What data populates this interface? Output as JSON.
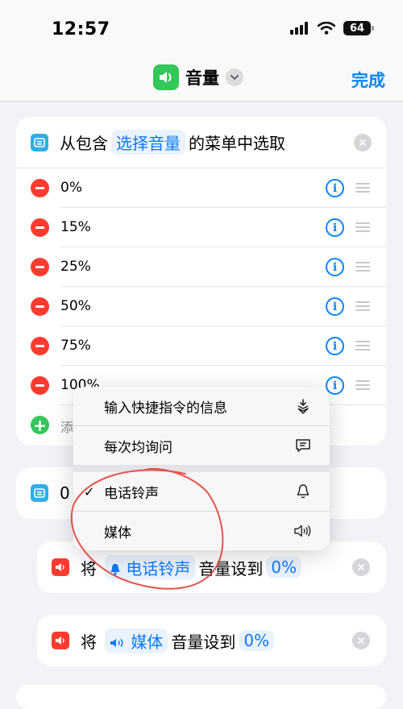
{
  "status": {
    "time": "12:57",
    "battery": "64"
  },
  "nav": {
    "title": "音量",
    "done": "完成"
  },
  "menu": {
    "header_prefix": "从包含",
    "header_token": "选择音量",
    "header_suffix": "的菜单中选取",
    "options": [
      "0%",
      "15%",
      "25%",
      "50%",
      "75%",
      "100%"
    ],
    "add_label": "添"
  },
  "otherwise": {
    "text": "0"
  },
  "popup": {
    "items": [
      {
        "label": "输入快捷指令的信息",
        "icon": "shortcut-input-icon"
      },
      {
        "label": "每次均询问",
        "icon": "ask-each-time-icon"
      },
      {
        "label": "电话铃声",
        "icon": "bell-icon",
        "checked": true
      },
      {
        "label": "媒体",
        "icon": "speaker-icon"
      }
    ]
  },
  "actions": [
    {
      "prefix": "将",
      "token": "电话铃声",
      "token_icon": "bell-icon",
      "middle": "音量设到",
      "value": "0%"
    },
    {
      "prefix": "将",
      "token": "媒体",
      "token_icon": "speaker-icon",
      "middle": "音量设到",
      "value": "0%"
    }
  ],
  "colors": {
    "accent": "#0a84ff",
    "delete": "#ff3b30",
    "add": "#34c759",
    "app": "#34c759",
    "annotation": "#e0423c"
  }
}
